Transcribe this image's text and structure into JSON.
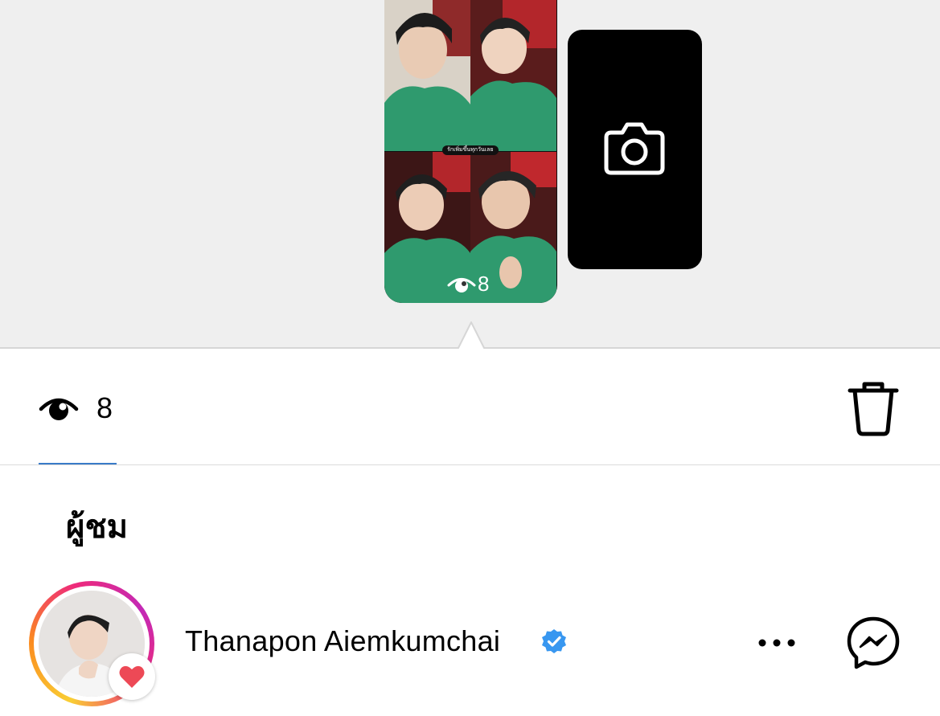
{
  "story_tray": {
    "thumbnail": {
      "caption": "รักเพิ่มขึ้นทุกวันเลย",
      "view_count": "8",
      "view_icon": "viewers-eye-icon"
    },
    "camera_card": {
      "icon": "camera-icon"
    }
  },
  "stats": {
    "view_icon": "viewers-eye-icon",
    "view_count": "8",
    "delete_icon": "trash-icon"
  },
  "viewers_section": {
    "title": "ผู้ชม",
    "viewers": [
      {
        "name": "Thanapon  Aiemkumchai",
        "verified": true,
        "liked": true,
        "avatar_ring": "story-ring-gradient",
        "actions": {
          "more_icon": "more-horizontal-icon",
          "message_icon": "messenger-icon"
        }
      }
    ]
  },
  "colors": {
    "top_background": "#efefef",
    "verified_blue": "#3897f0",
    "heart_red": "#ed4956",
    "tab_underline": "#3a7bc8",
    "jacket_green": "#2f9a6e"
  }
}
